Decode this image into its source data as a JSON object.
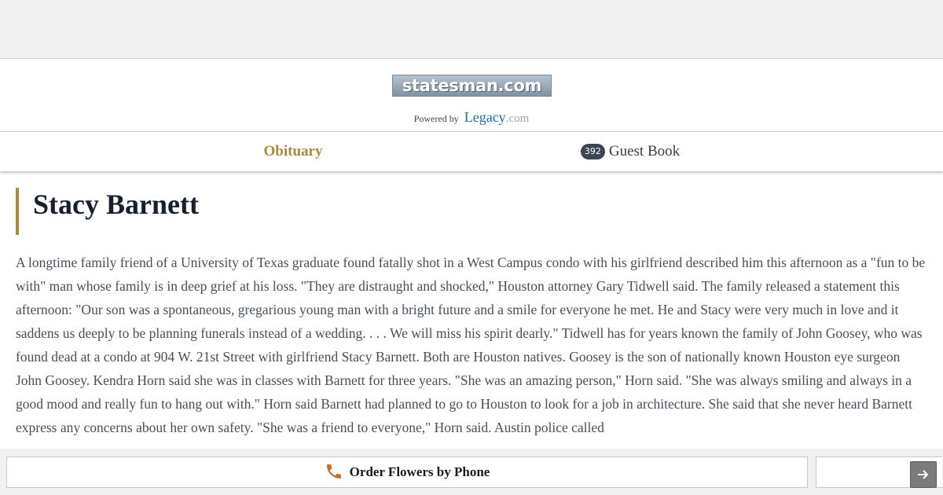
{
  "header": {
    "site_logo": "statesman.com",
    "powered_by": "Powered by",
    "legacy_name": "Legacy",
    "legacy_tld": ".com"
  },
  "tabs": {
    "obituary": "Obituary",
    "guestbook_count": "392",
    "guestbook": "Guest Book"
  },
  "obituary": {
    "name": "Stacy Barnett",
    "text": "A longtime family friend of a University of Texas graduate found fatally shot in a West Campus condo with his girlfriend described him this afternoon as a \"fun to be with\" man whose family is in deep grief at his loss. \"They are distraught and shocked,\" Houston attorney Gary Tidwell said. The family released a statement this afternoon: \"Our son was a spontaneous, gregarious young man with a bright future and a smile for everyone he met. He and Stacy were very much in love and it saddens us deeply to be planning funerals instead of a wedding. . . . We will miss his spirit dearly.\" Tidwell has for years known the family of John Goosey, who was found dead at a condo at 904 W. 21st Street with girlfriend Stacy Barnett. Both are Houston natives. Goosey is the son of nationally known Houston eye surgeon John Goosey. Kendra Horn said she was in classes with Barnett for three years. \"She was an amazing person,\" Horn said. \"She was always smiling and always in a good mood and really fun to hang out with.\" Horn said Barnett had planned to go to Houston to look for a job in architecture. She said that she never heard Barnett express any concerns about her own safety. \"She was a friend to everyone,\" Horn said. Austin police called"
  },
  "footer": {
    "order_flowers": "Order Flowers by Phone"
  },
  "colors": {
    "accent_gold": "#a68a3d",
    "phone_icon": "#d2691e",
    "badge_bg": "#3b4553"
  },
  "icons": {
    "phone": "phone-icon",
    "next": "arrow-right-icon"
  }
}
